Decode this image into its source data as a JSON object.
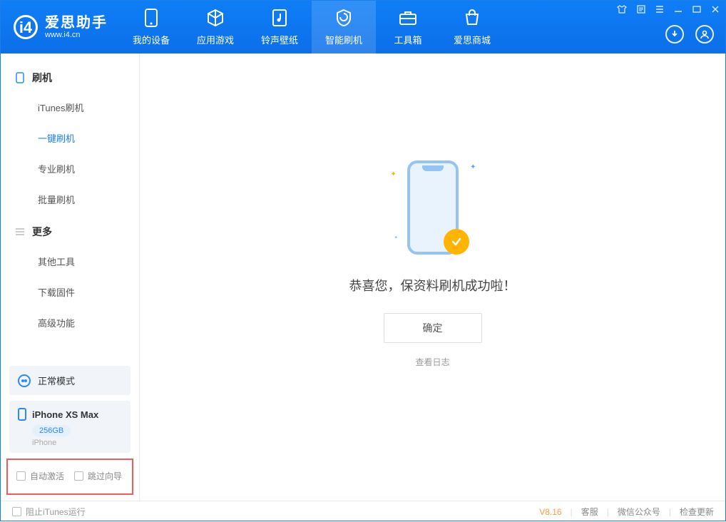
{
  "logo": {
    "cn": "爱思助手",
    "en": "www.i4.cn"
  },
  "nav": {
    "tabs": [
      {
        "label": "我的设备",
        "icon": "device"
      },
      {
        "label": "应用游戏",
        "icon": "cube"
      },
      {
        "label": "铃声壁纸",
        "icon": "music"
      },
      {
        "label": "智能刷机",
        "icon": "shield",
        "active": true
      },
      {
        "label": "工具箱",
        "icon": "toolbox"
      },
      {
        "label": "爱思商城",
        "icon": "shop"
      }
    ]
  },
  "sidebar": {
    "section1": {
      "title": "刷机",
      "items": [
        "iTunes刷机",
        "一键刷机",
        "专业刷机",
        "批量刷机"
      ],
      "activeIndex": 1
    },
    "section2": {
      "title": "更多",
      "items": [
        "其他工具",
        "下载固件",
        "高级功能"
      ]
    },
    "mode": {
      "label": "正常模式"
    },
    "device": {
      "name": "iPhone XS Max",
      "storage": "256GB",
      "sub": "iPhone"
    },
    "checkboxes": {
      "cb1": "自动激活",
      "cb2": "跳过向导"
    }
  },
  "content": {
    "success_text": "恭喜您，保资料刷机成功啦！",
    "confirm_label": "确定",
    "view_log": "查看日志"
  },
  "footer": {
    "block_itunes": "阻止iTunes运行",
    "version": "V8.16",
    "links": [
      "客服",
      "微信公众号",
      "检查更新"
    ]
  }
}
